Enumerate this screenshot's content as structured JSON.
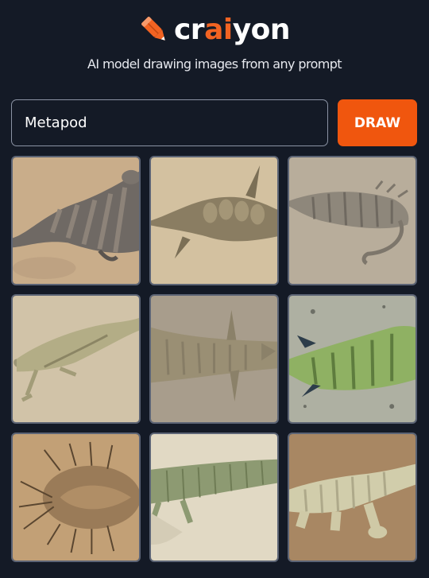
{
  "header": {
    "logo_icon": "pencil-icon",
    "logo_text_before": "cr",
    "logo_text_accent": "ai",
    "logo_text_after": "yon",
    "tagline": "AI model drawing images from any prompt"
  },
  "colors": {
    "background": "#141a26",
    "accent": "#f0560e",
    "logo_accent": "#f26322",
    "input_border": "#8b93a4",
    "tile_border": "#5c6475"
  },
  "prompt": {
    "value": "Metapod",
    "button_label": "DRAW"
  },
  "gallery": {
    "rows": 3,
    "columns": 3,
    "image_count": 9
  }
}
